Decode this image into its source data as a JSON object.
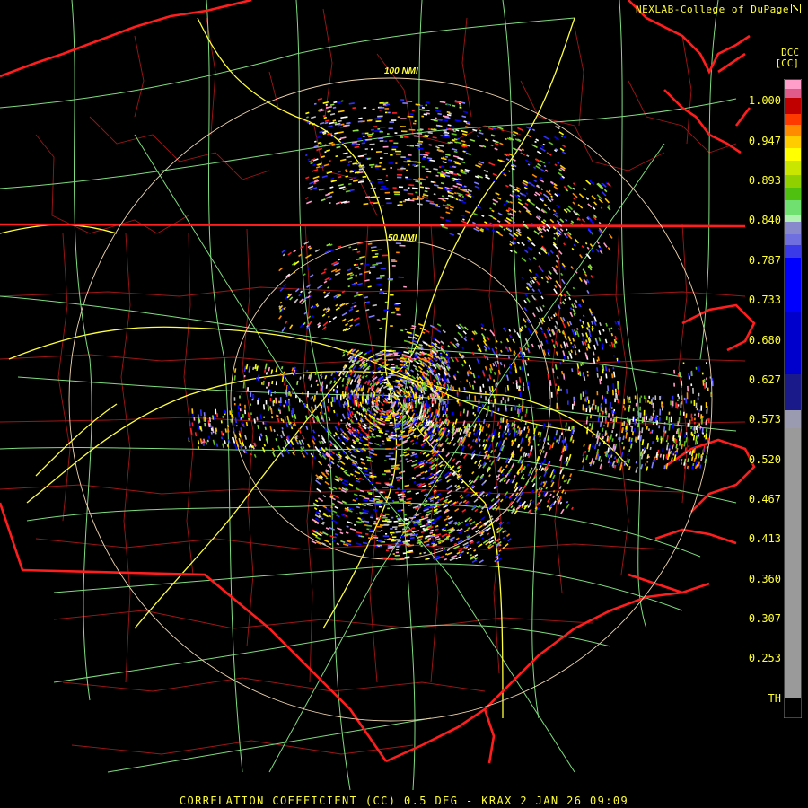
{
  "credit": "NEXLAB-College of DuPage",
  "credit_icon": "expand-icon",
  "legend": {
    "product": "DCC",
    "unit": "[CC]",
    "ticks": [
      "1.000",
      "0.947",
      "0.893",
      "0.840",
      "0.787",
      "0.733",
      "0.680",
      "0.627",
      "0.573",
      "0.520",
      "0.467",
      "0.413",
      "0.360",
      "0.307",
      "0.253",
      "TH"
    ]
  },
  "ring_labels": [
    "100 NMI",
    "50 NMI"
  ],
  "footer": "CORRELATION COEFFICIENT (CC) 0.5 DEG - KRAX 2 JAN 26 09:09",
  "colors": {
    "text": "#ffff33",
    "state_border": "#ff2020",
    "county_border": "#b01818",
    "interstate": "#ffff40",
    "highway": "#80e080",
    "range_ring": "#f2d7b0",
    "background": "#000000"
  }
}
